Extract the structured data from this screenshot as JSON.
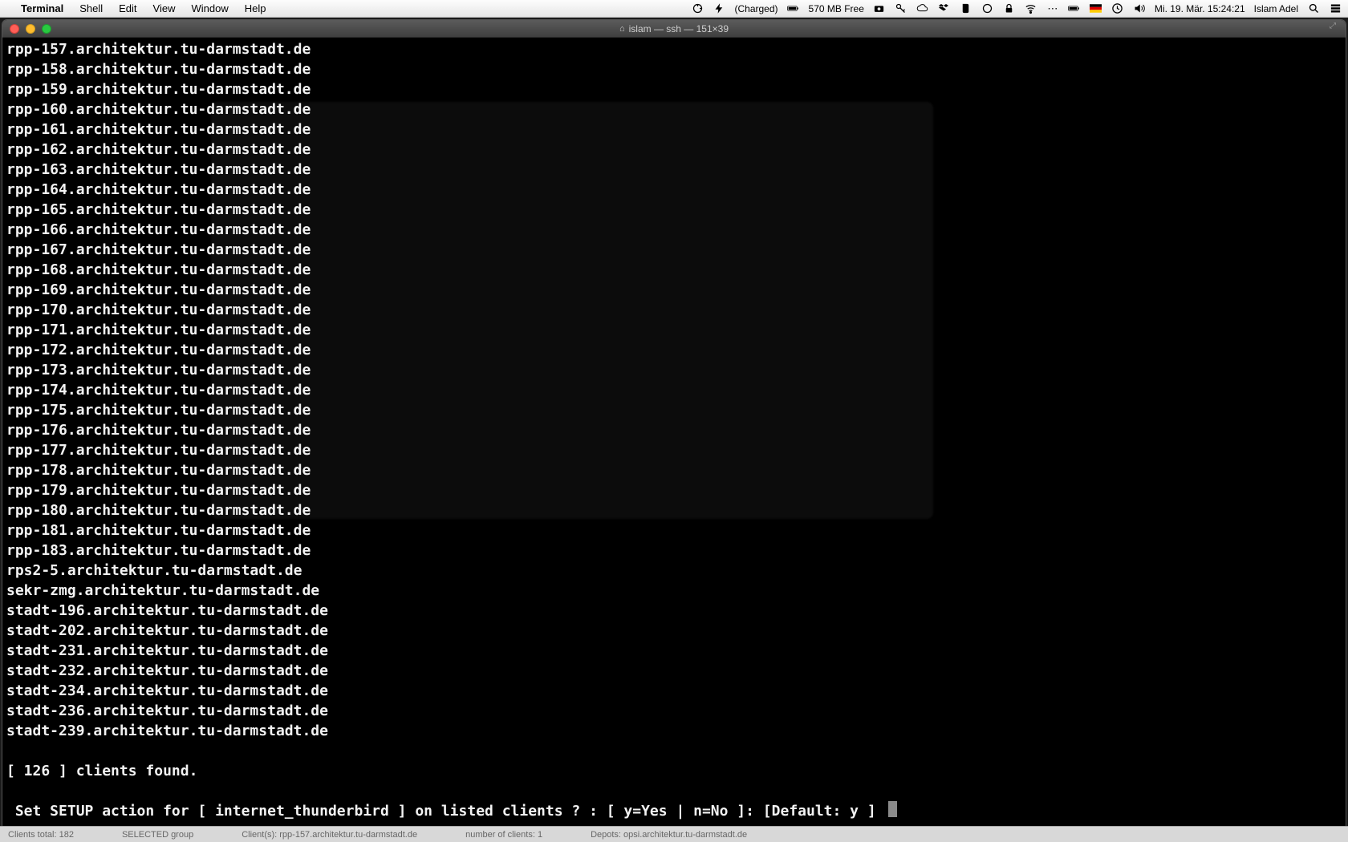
{
  "menubar": {
    "app": "Terminal",
    "items": [
      "Shell",
      "Edit",
      "View",
      "Window",
      "Help"
    ],
    "battery_text": "(Charged)",
    "mem_free": "570 MB Free",
    "clock": "Mi. 19. Mär.  15:24:21",
    "user": "Islam Adel"
  },
  "window": {
    "title": "islam — ssh — 151×39"
  },
  "terminal": {
    "lines": [
      "rpp-157.architektur.tu-darmstadt.de",
      "rpp-158.architektur.tu-darmstadt.de",
      "rpp-159.architektur.tu-darmstadt.de",
      "rpp-160.architektur.tu-darmstadt.de",
      "rpp-161.architektur.tu-darmstadt.de",
      "rpp-162.architektur.tu-darmstadt.de",
      "rpp-163.architektur.tu-darmstadt.de",
      "rpp-164.architektur.tu-darmstadt.de",
      "rpp-165.architektur.tu-darmstadt.de",
      "rpp-166.architektur.tu-darmstadt.de",
      "rpp-167.architektur.tu-darmstadt.de",
      "rpp-168.architektur.tu-darmstadt.de",
      "rpp-169.architektur.tu-darmstadt.de",
      "rpp-170.architektur.tu-darmstadt.de",
      "rpp-171.architektur.tu-darmstadt.de",
      "rpp-172.architektur.tu-darmstadt.de",
      "rpp-173.architektur.tu-darmstadt.de",
      "rpp-174.architektur.tu-darmstadt.de",
      "rpp-175.architektur.tu-darmstadt.de",
      "rpp-176.architektur.tu-darmstadt.de",
      "rpp-177.architektur.tu-darmstadt.de",
      "rpp-178.architektur.tu-darmstadt.de",
      "rpp-179.architektur.tu-darmstadt.de",
      "rpp-180.architektur.tu-darmstadt.de",
      "rpp-181.architektur.tu-darmstadt.de",
      "rpp-183.architektur.tu-darmstadt.de",
      "rps2-5.architektur.tu-darmstadt.de",
      "sekr-zmg.architektur.tu-darmstadt.de",
      "stadt-196.architektur.tu-darmstadt.de",
      "stadt-202.architektur.tu-darmstadt.de",
      "stadt-231.architektur.tu-darmstadt.de",
      "stadt-232.architektur.tu-darmstadt.de",
      "stadt-234.architektur.tu-darmstadt.de",
      "stadt-236.architektur.tu-darmstadt.de",
      "stadt-239.architektur.tu-darmstadt.de"
    ],
    "count_line": "[ 126 ] clients found.",
    "prompt": " Set SETUP action for [ internet_thunderbird ] on listed clients ? : [ y=Yes | n=No ]: [Default: y ] "
  },
  "bottom": {
    "clients_total": "Clients total: 182",
    "selected": "SELECTED  group",
    "client": "Client(s): rpp-157.architektur.tu-darmstadt.de",
    "num_clients": "number of clients:   1",
    "depots": "Depots: opsi.architektur.tu-darmstadt.de"
  }
}
